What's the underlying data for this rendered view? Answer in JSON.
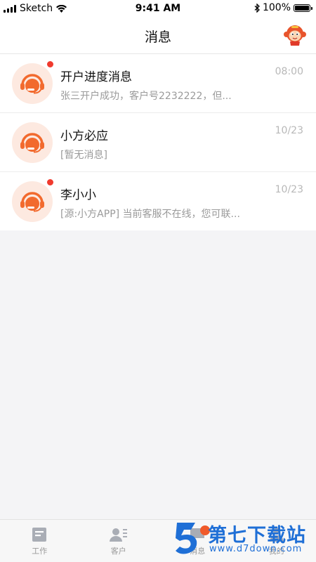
{
  "status_bar": {
    "carrier": "Sketch",
    "time": "9:41 AM",
    "battery": "100%"
  },
  "nav": {
    "title": "消息",
    "avatar_icon": "monkey-mascot-icon"
  },
  "messages": [
    {
      "title": "开户进度消息",
      "time": "08:00",
      "preview": "张三开户成功，客户号2232222，但...",
      "unread": true,
      "icon": "customer-service-headset-icon"
    },
    {
      "title": "小方必应",
      "time": "10/23",
      "preview": "[暂无消息]",
      "unread": false,
      "icon": "customer-service-headset-icon"
    },
    {
      "title": "李小小",
      "time": "10/23",
      "preview": "[源:小方APP] 当前客服不在线，您可联...",
      "unread": true,
      "icon": "customer-service-headset-icon"
    }
  ],
  "tabs": [
    {
      "label": "工作",
      "icon": "document-icon"
    },
    {
      "label": "客户",
      "icon": "contacts-icon"
    },
    {
      "label": "消息",
      "icon": "message-icon"
    },
    {
      "label": "我的",
      "icon": "person-icon"
    }
  ],
  "watermark": {
    "main": "第七下载站",
    "sub": "www.d7down.com"
  },
  "colors": {
    "accent": "#f05a2a",
    "unread_dot": "#f03a2e",
    "avatar_bg": "#fde9e0",
    "watermark": "#1f6fd6"
  }
}
